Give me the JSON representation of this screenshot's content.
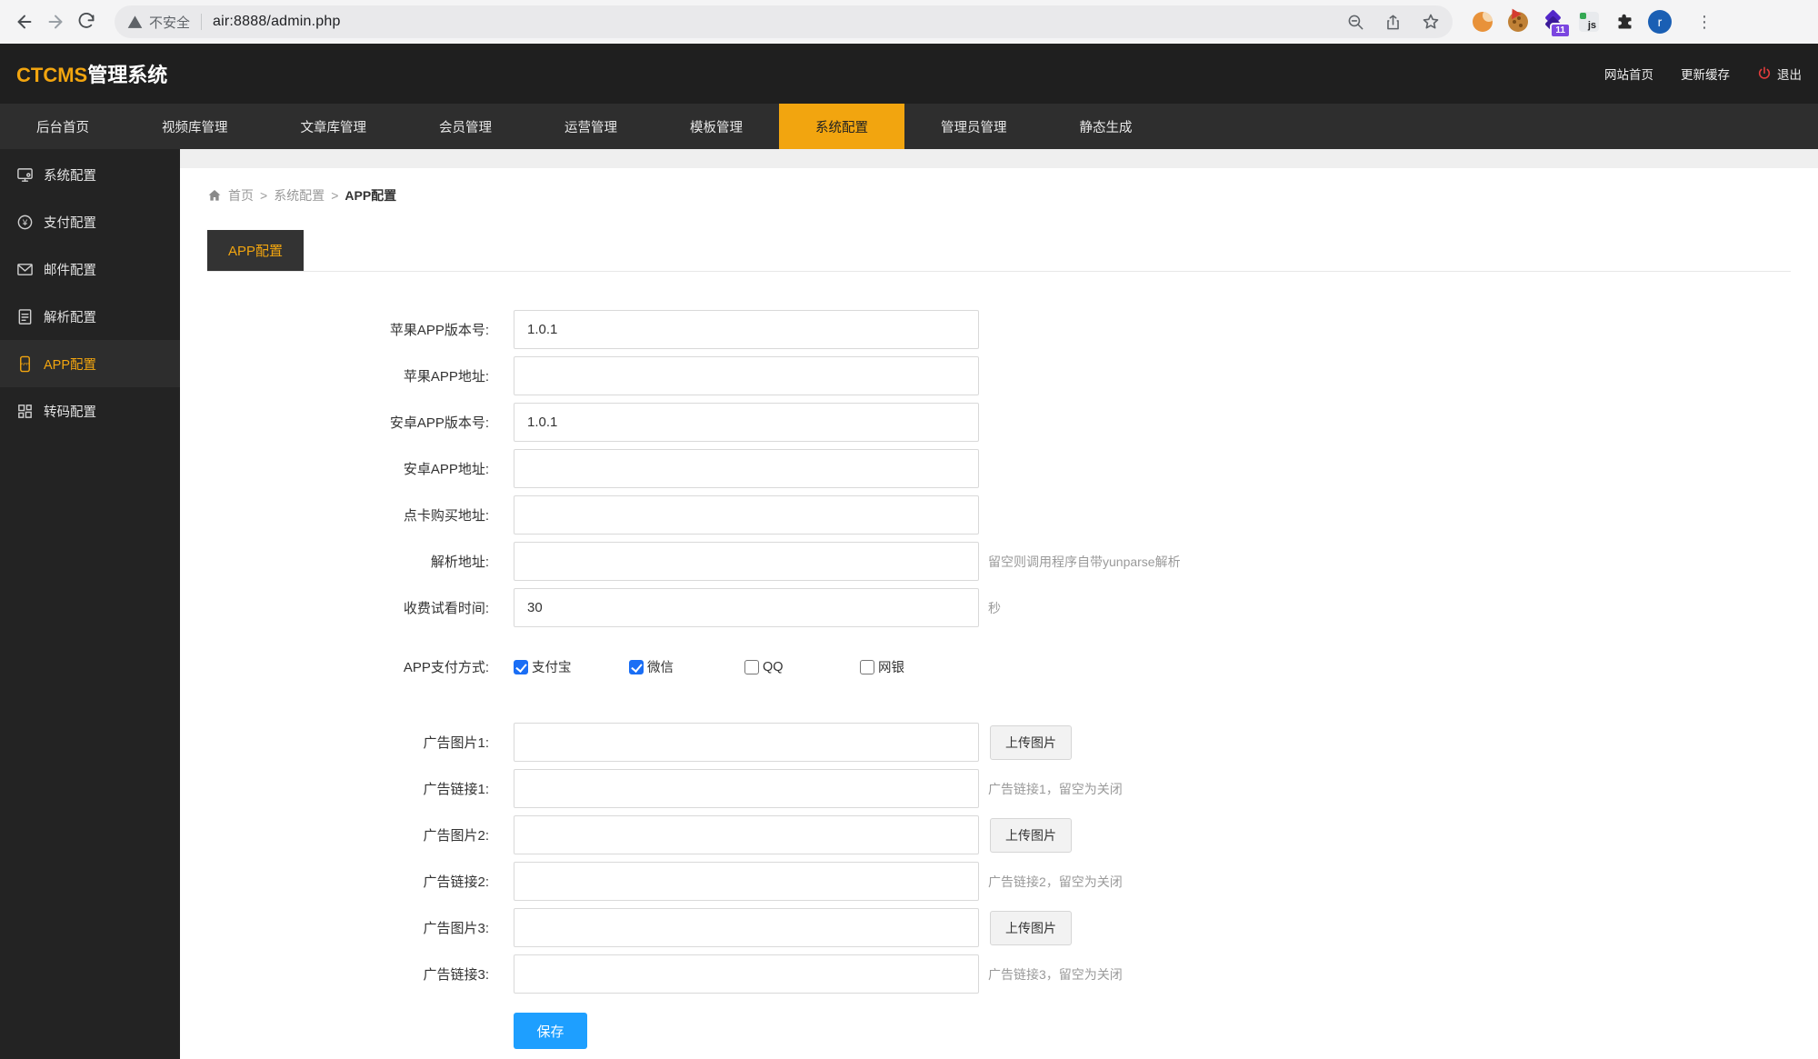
{
  "browser": {
    "security_warning": "不安全",
    "url": "air:8888/admin.php",
    "extensions_badge": "11",
    "ext_js_label": "js",
    "avatar_letter": "r"
  },
  "header": {
    "logo_brand": "CTCMS",
    "logo_suffix": "管理系统",
    "link_site_home": "网站首页",
    "link_refresh_cache": "更新缓存",
    "link_logout": "退出"
  },
  "nav": {
    "items": [
      {
        "label": "后台首页",
        "active": false
      },
      {
        "label": "视频库管理",
        "active": false
      },
      {
        "label": "文章库管理",
        "active": false
      },
      {
        "label": "会员管理",
        "active": false
      },
      {
        "label": "运营管理",
        "active": false
      },
      {
        "label": "模板管理",
        "active": false
      },
      {
        "label": "系统配置",
        "active": true
      },
      {
        "label": "管理员管理",
        "active": false
      },
      {
        "label": "静态生成",
        "active": false
      }
    ]
  },
  "sidebar": {
    "items": [
      {
        "label": "系统配置",
        "icon": "monitor-icon",
        "active": false
      },
      {
        "label": "支付配置",
        "icon": "payment-icon",
        "active": false
      },
      {
        "label": "邮件配置",
        "icon": "mail-icon",
        "active": false
      },
      {
        "label": "解析配置",
        "icon": "parse-doc-icon",
        "active": false
      },
      {
        "label": "APP配置",
        "icon": "app-phone-icon",
        "active": true
      },
      {
        "label": "转码配置",
        "icon": "transcode-grid-icon",
        "active": false
      }
    ]
  },
  "breadcrumb": {
    "separator": ">",
    "items": [
      "首页",
      "系统配置",
      "APP配置"
    ]
  },
  "tab": {
    "label": "APP配置"
  },
  "form": {
    "fields": [
      {
        "label": "苹果APP版本号:",
        "value": "1.0.1",
        "hint": ""
      },
      {
        "label": "苹果APP地址:",
        "value": "",
        "hint": ""
      },
      {
        "label": "安卓APP版本号:",
        "value": "1.0.1",
        "hint": ""
      },
      {
        "label": "安卓APP地址:",
        "value": "",
        "hint": ""
      },
      {
        "label": "点卡购买地址:",
        "value": "",
        "hint": ""
      },
      {
        "label": "解析地址:",
        "value": "",
        "hint": "留空则调用程序自带yunparse解析"
      },
      {
        "label": "收费试看时间:",
        "value": "30",
        "hint": "秒"
      }
    ],
    "payment": {
      "label": "APP支付方式:",
      "options": [
        {
          "label": "支付宝",
          "checked": true
        },
        {
          "label": "微信",
          "checked": true
        },
        {
          "label": "QQ",
          "checked": false
        },
        {
          "label": "网银",
          "checked": false
        }
      ]
    },
    "ad_fields": [
      {
        "label": "广告图片1:",
        "value": "",
        "button": "上传图片",
        "hint": ""
      },
      {
        "label": "广告链接1:",
        "value": "",
        "button": "",
        "hint": "广告链接1，留空为关闭"
      },
      {
        "label": "广告图片2:",
        "value": "",
        "button": "上传图片",
        "hint": ""
      },
      {
        "label": "广告链接2:",
        "value": "",
        "button": "",
        "hint": "广告链接2，留空为关闭"
      },
      {
        "label": "广告图片3:",
        "value": "",
        "button": "上传图片",
        "hint": ""
      },
      {
        "label": "广告链接3:",
        "value": "",
        "button": "",
        "hint": "广告链接3，留空为关闭"
      }
    ],
    "save_label": "保存"
  },
  "colors": {
    "accent_orange": "#F2A50F",
    "save_blue": "#1E9FFF",
    "checkbox_blue": "#1A6EF5",
    "power_red": "#E23C3C",
    "header_bg": "#1F1F1F",
    "nav_bg": "#2E2E2E",
    "sidebar_bg": "#232323"
  }
}
